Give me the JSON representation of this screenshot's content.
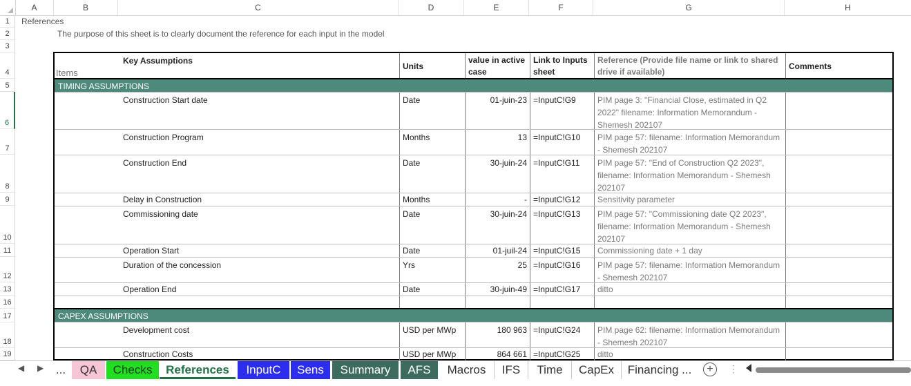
{
  "columns": [
    "A",
    "B",
    "C",
    "D",
    "E",
    "F",
    "G",
    "H"
  ],
  "rows": [
    {
      "num": "1"
    },
    {
      "num": "2"
    },
    {
      "num": "3"
    },
    {
      "num": "4"
    },
    {
      "num": "5"
    },
    {
      "num": "6"
    },
    {
      "num": "7"
    },
    {
      "num": "8"
    },
    {
      "num": "9"
    },
    {
      "num": "10"
    },
    {
      "num": "11"
    },
    {
      "num": "12"
    },
    {
      "num": "13"
    },
    {
      "num": "16"
    },
    {
      "num": "17"
    },
    {
      "num": "18"
    },
    {
      "num": "19"
    }
  ],
  "sheet": {
    "title": "References",
    "subtitle": "The purpose of this sheet is to clearly document the reference for each input in the model"
  },
  "table": {
    "header": {
      "key_assumptions": "Key Assumptions",
      "items": "Items",
      "units": "Units",
      "value": "value in active case",
      "link": "Link to Inputs sheet",
      "reference": "Reference (Provide file name or link to shared drive if available)",
      "comments": "Comments"
    },
    "section_timing": "TIMING ASSUMPTIONS",
    "section_capex": "CAPEX ASSUMPTIONS",
    "timing_rows": [
      {
        "label": "Construction Start date",
        "units": "Date",
        "value": "01-juin-23",
        "link": "=InputC!G9",
        "reference": "PIM page 3: \"Financial Close, estimated in Q2 2022\" filename: Information Memorandum - Shemesh 202107"
      },
      {
        "label": "Construction Program",
        "units": "Months",
        "value": "13",
        "link": "=InputC!G10",
        "reference": "PIM page 57: filename: Information Memorandum - Shemesh 202107"
      },
      {
        "label": "Construction End",
        "units": "Date",
        "value": "30-juin-24",
        "link": "=InputC!G11",
        "reference": "PIM page 57: \"End of Construction Q2 2023\", filename: Information Memorandum - Shemesh 202107"
      },
      {
        "label": "Delay in Construction",
        "units": "Months",
        "value": "-",
        "link": "=InputC!G12",
        "reference": "Sensitivity parameter"
      },
      {
        "label": "Commissioning date",
        "units": "Date",
        "value": "30-juin-24",
        "link": "=InputC!G13",
        "reference": "PIM page 57: \"Commissioning date Q2 2023\", filename: Information Memorandum - Shemesh 202107"
      },
      {
        "label": "Operation Start",
        "units": "Date",
        "value": "01-juil-24",
        "link": "=InputC!G15",
        "reference": "Commissioning date + 1 day"
      },
      {
        "label": "Duration of the concession",
        "units": "Yrs",
        "value": "25",
        "link": "=InputC!G16",
        "reference": "PIM page 57: filename: Information Memorandum - Shemesh 202107"
      },
      {
        "label": "Operation End",
        "units": "Date",
        "value": "30-juin-49",
        "link": "=InputC!G17",
        "reference": "ditto"
      }
    ],
    "capex_rows": [
      {
        "label": "Development cost",
        "units": "USD per MWp",
        "value": "180 963",
        "link": "=InputC!G24",
        "reference": "PIM page 62: filename: Information Memorandum - Shemesh 202107"
      },
      {
        "label": "Construction Costs",
        "units": "USD per MWp",
        "value": "864 661",
        "link": "=InputC!G25",
        "reference": "ditto"
      }
    ]
  },
  "tabs": [
    {
      "label": "...",
      "color": "#ffffff",
      "text": "#333333"
    },
    {
      "label": "QA",
      "color": "#f7c6d6",
      "text": "#333333"
    },
    {
      "label": "Checks",
      "color": "#22dd22",
      "text": "#1a3a1a"
    },
    {
      "label": "References",
      "color": "#ffffff",
      "text": "#217346",
      "active": true
    },
    {
      "label": "InputC",
      "color": "#2d2df0",
      "text": "#ffffff"
    },
    {
      "label": "Sens",
      "color": "#2d2df0",
      "text": "#ffffff"
    },
    {
      "label": "Summary",
      "color": "#3d6b5e",
      "text": "#ffffff"
    },
    {
      "label": "AFS",
      "color": "#3d6b5e",
      "text": "#ffffff"
    },
    {
      "label": "Macros",
      "color": "#ffffff",
      "text": "#333333"
    },
    {
      "label": "IFS",
      "color": "#ffffff",
      "text": "#333333"
    },
    {
      "label": "Time",
      "color": "#ffffff",
      "text": "#333333"
    },
    {
      "label": "CapEx",
      "color": "#ffffff",
      "text": "#333333"
    },
    {
      "label": "Financing ...",
      "color": "#ffffff",
      "text": "#333333"
    }
  ],
  "icons": {
    "prev": "triangle-left-icon",
    "next": "triangle-right-icon",
    "add": "plus-circle-icon"
  }
}
